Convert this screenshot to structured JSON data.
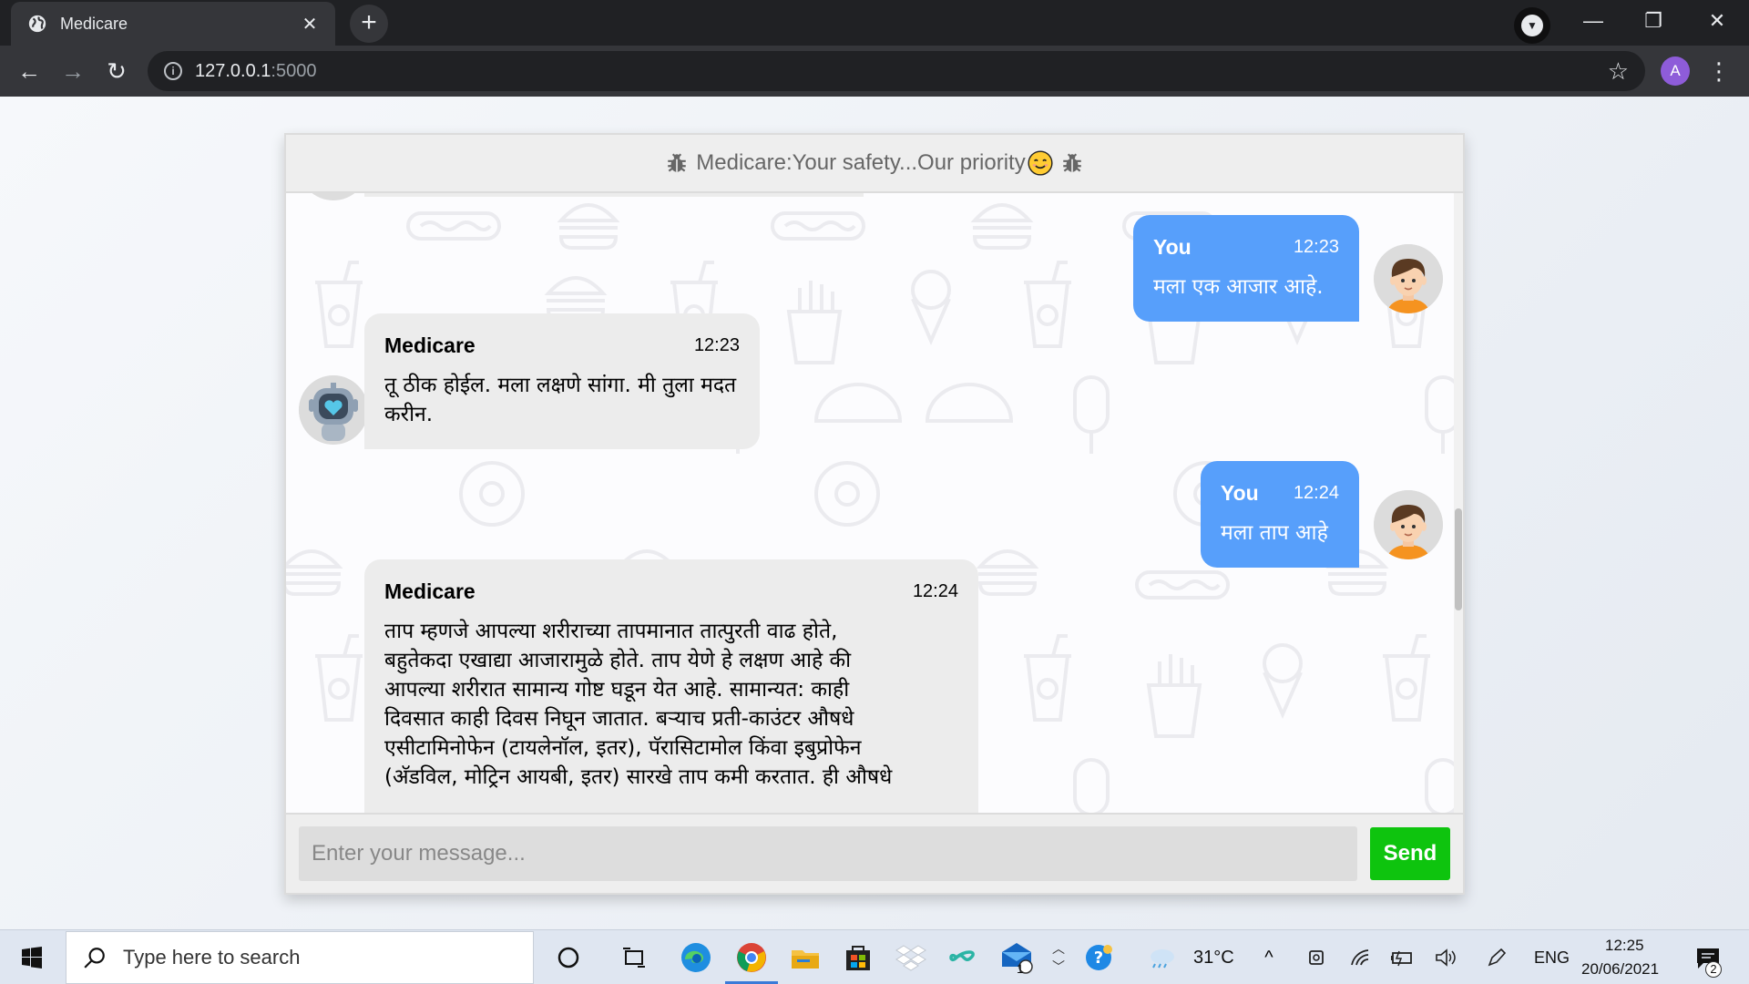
{
  "browser": {
    "tab_title": "Medicare",
    "url_host": "127.0.0.1",
    "url_port": ":5000",
    "profile_initial": "A"
  },
  "chat": {
    "header_text": "Medicare:Your safety...Our priority",
    "messages": [
      {
        "sender": "You",
        "time": "12:23",
        "text": "मला एक आजार आहे.",
        "side": "right"
      },
      {
        "sender": "Medicare",
        "time": "12:23",
        "text": "तू ठीक होईल. मला लक्षणे सांगा. मी तुला मदत करीन.",
        "side": "left"
      },
      {
        "sender": "You",
        "time": "12:24",
        "text": "मला ताप आहे",
        "side": "right"
      },
      {
        "sender": "Medicare",
        "time": "12:24",
        "lines": [
          "ताप म्हणजे आपल्या शरीराच्या तापमानात तात्पुरती वाढ होते,",
          "बहुतेकदा एखाद्या आजारामुळे होते. ताप येणे हे लक्षण आहे की",
          "आपल्या शरीरात सामान्य गोष्ट घडून येत आहे. सामान्यत: काही",
          "दिवसात काही दिवस निघून जातात. बर्‍याच प्रती-काउंटर औषधे",
          "एसीटामिनोफेन (टायलेनॉल, इतर), पॅरासिटामोल किंवा इबुप्रोफेन",
          "(अ‍ॅडविल, मोट्रिन आयबी, इतर) सारखे ताप कमी करतात. ही औषधे"
        ],
        "side": "left"
      }
    ],
    "input_placeholder": "Enter your message...",
    "send_label": "Send"
  },
  "taskbar": {
    "search_placeholder": "Type here to search",
    "weather": "31°C",
    "language": "ENG",
    "time": "12:25",
    "date": "20/06/2021",
    "mail_badge": "1",
    "notification_badge": "2"
  },
  "colors": {
    "user_bubble": "#579ffb",
    "bot_bubble": "#ececec",
    "send_button": "#0ec40e",
    "browser_dark": "#202124"
  }
}
